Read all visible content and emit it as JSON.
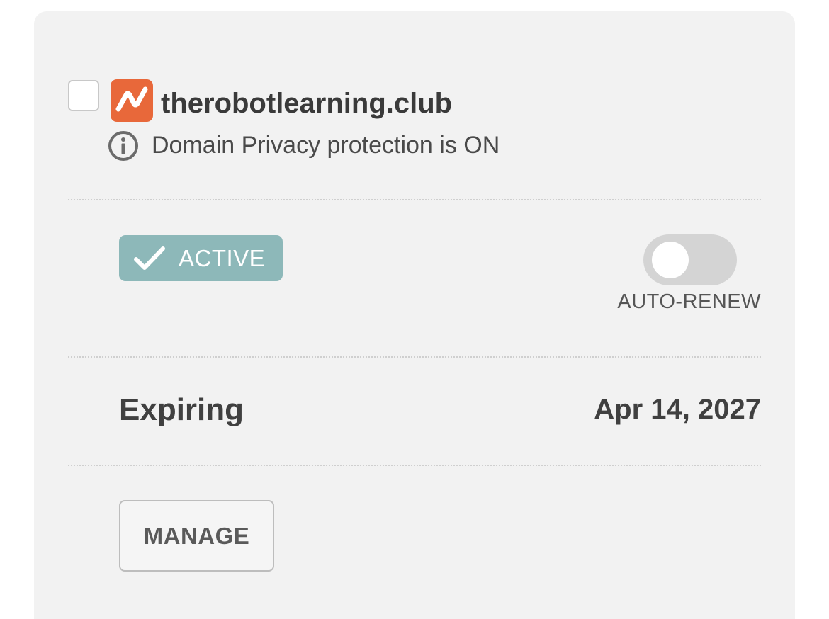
{
  "domain": {
    "name": "therobotlearning.club",
    "privacy_text": "Domain Privacy protection is ON",
    "selected": false
  },
  "status": {
    "label": "ACTIVE",
    "color": "#8db8b9"
  },
  "auto_renew": {
    "label": "AUTO-RENEW",
    "enabled": false
  },
  "expiring": {
    "label": "Expiring",
    "date": "Apr 14, 2027"
  },
  "actions": {
    "manage_label": "MANAGE"
  },
  "brand": {
    "logo_icon": "namecheap-logo-icon",
    "accent_color": "#e8683a"
  }
}
